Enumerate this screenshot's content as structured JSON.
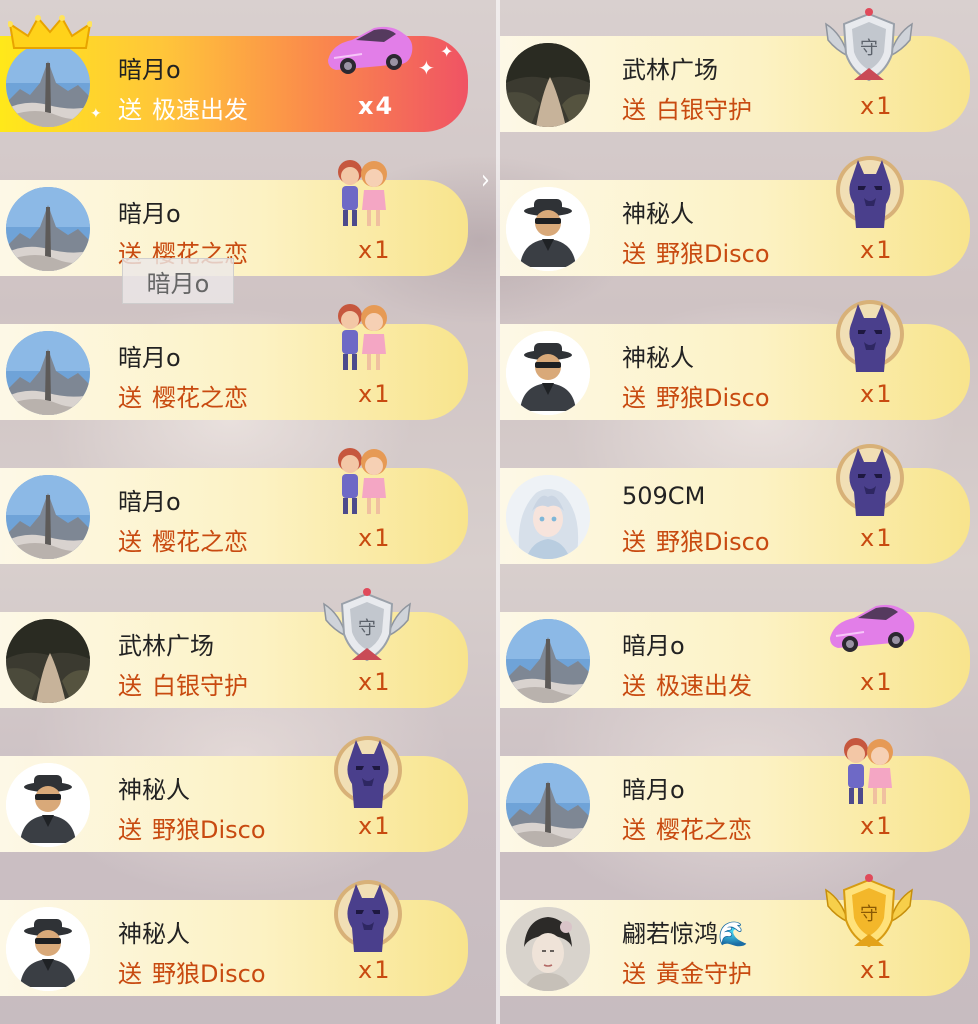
{
  "tooltip": {
    "text": "暗月o"
  },
  "colors": {
    "send_text": "#c84a10",
    "name_text": "#222222",
    "card_fill": "#fcf2c4",
    "highlight_fill": "#fb8e4a"
  },
  "left_column": [
    {
      "user": "暗月o",
      "send": "送",
      "gift": "极速出发",
      "count": "x4",
      "avatar_icon": "snow-mountain-avatar",
      "gift_icon": "pink-sports-car-icon",
      "highlight": true
    },
    {
      "user": "暗月o",
      "send": "送",
      "gift": "樱花之恋",
      "count": "x1",
      "avatar_icon": "snow-mountain-avatar",
      "gift_icon": "couple-icon"
    },
    {
      "user": "暗月o",
      "send": "送",
      "gift": "樱花之恋",
      "count": "x1",
      "avatar_icon": "snow-mountain-avatar",
      "gift_icon": "couple-icon"
    },
    {
      "user": "暗月o",
      "send": "送",
      "gift": "樱花之恋",
      "count": "x1",
      "avatar_icon": "snow-mountain-avatar",
      "gift_icon": "couple-icon"
    },
    {
      "user": "武林广场",
      "send": "送",
      "gift": "白银守护",
      "count": "x1",
      "avatar_icon": "forest-path-avatar",
      "gift_icon": "silver-guard-badge-icon"
    },
    {
      "user": "神秘人",
      "send": "送",
      "gift": "野狼Disco",
      "count": "x1",
      "avatar_icon": "mystery-man-avatar",
      "gift_icon": "wolf-disco-icon"
    },
    {
      "user": "神秘人",
      "send": "送",
      "gift": "野狼Disco",
      "count": "x1",
      "avatar_icon": "mystery-man-avatar",
      "gift_icon": "wolf-disco-icon"
    }
  ],
  "right_column": [
    {
      "user": "武林广场",
      "send": "送",
      "gift": "白银守护",
      "count": "x1",
      "avatar_icon": "forest-path-avatar",
      "gift_icon": "silver-guard-badge-icon"
    },
    {
      "user": "神秘人",
      "send": "送",
      "gift": "野狼Disco",
      "count": "x1",
      "avatar_icon": "mystery-man-avatar",
      "gift_icon": "wolf-disco-icon"
    },
    {
      "user": "神秘人",
      "send": "送",
      "gift": "野狼Disco",
      "count": "x1",
      "avatar_icon": "mystery-man-avatar",
      "gift_icon": "wolf-disco-icon"
    },
    {
      "user": "509CM",
      "send": "送",
      "gift": "野狼Disco",
      "count": "x1",
      "avatar_icon": "anime-character-avatar",
      "gift_icon": "wolf-disco-icon"
    },
    {
      "user": "暗月o",
      "send": "送",
      "gift": "极速出发",
      "count": "x1",
      "avatar_icon": "snow-mountain-avatar",
      "gift_icon": "pink-sports-car-icon"
    },
    {
      "user": "暗月o",
      "send": "送",
      "gift": "樱花之恋",
      "count": "x1",
      "avatar_icon": "snow-mountain-avatar",
      "gift_icon": "couple-icon"
    },
    {
      "user": "翩若惊鸿🌊",
      "send": "送",
      "gift": "黃金守护",
      "count": "x1",
      "avatar_icon": "woman-portrait-avatar",
      "gift_icon": "gold-guard-badge-icon"
    }
  ]
}
